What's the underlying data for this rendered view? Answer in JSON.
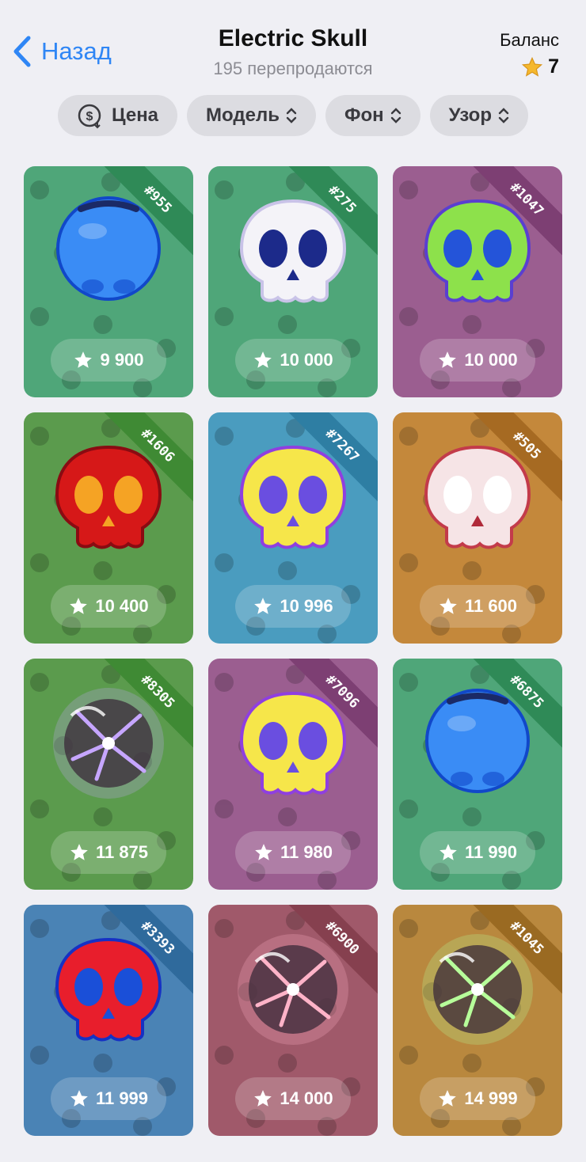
{
  "header": {
    "back_label": "Назад",
    "title": "Electric Skull",
    "subtitle": "195 перепродаются",
    "balance_label": "Баланс",
    "balance_value": "7"
  },
  "filters": [
    {
      "label": "Цена",
      "icon": "price-sort-icon"
    },
    {
      "label": "Модель",
      "icon": "chevron-updown-icon"
    },
    {
      "label": "Фон",
      "icon": "chevron-updown-icon"
    },
    {
      "label": "Узор",
      "icon": "chevron-updown-icon"
    }
  ],
  "colors": {
    "accent": "#2f86f5",
    "star": "#f5b82e"
  },
  "items": [
    {
      "number": "#955",
      "price": "9 900",
      "bg": "#4fa679",
      "ribbon": "#2f8a57",
      "model": "blue-orb-skull"
    },
    {
      "number": "#275",
      "price": "10 000",
      "bg": "#4fa679",
      "ribbon": "#2f8a57",
      "model": "white-skull"
    },
    {
      "number": "#1047",
      "price": "10 000",
      "bg": "#9b5e90",
      "ribbon": "#7d3f73",
      "model": "green-skull"
    },
    {
      "number": "#1606",
      "price": "10 400",
      "bg": "#5b9b4d",
      "ribbon": "#3f8a34",
      "model": "red-skull"
    },
    {
      "number": "#7267",
      "price": "10 996",
      "bg": "#4a9cbf",
      "ribbon": "#2e7ea3",
      "model": "yellow-skull"
    },
    {
      "number": "#505",
      "price": "11 600",
      "bg": "#c4883b",
      "ribbon": "#a66a22",
      "model": "pink-skull"
    },
    {
      "number": "#8305",
      "price": "11 875",
      "bg": "#5b9b4d",
      "ribbon": "#3f8a34",
      "model": "electric-orb"
    },
    {
      "number": "#7096",
      "price": "11 980",
      "bg": "#9b5e90",
      "ribbon": "#7d3f73",
      "model": "yellow-skull"
    },
    {
      "number": "#6875",
      "price": "11 990",
      "bg": "#4fa679",
      "ribbon": "#2f8a57",
      "model": "blue-orb-skull"
    },
    {
      "number": "#3393",
      "price": "11 999",
      "bg": "#4a83b5",
      "ribbon": "#2f6a9c",
      "model": "red-blue-skull"
    },
    {
      "number": "#6900",
      "price": "14 000",
      "bg": "#a0596a",
      "ribbon": "#86404f",
      "model": "electric-orb-pink"
    },
    {
      "number": "#1045",
      "price": "14 999",
      "bg": "#b9883e",
      "ribbon": "#9a6a22",
      "model": "electric-orb-green"
    }
  ]
}
